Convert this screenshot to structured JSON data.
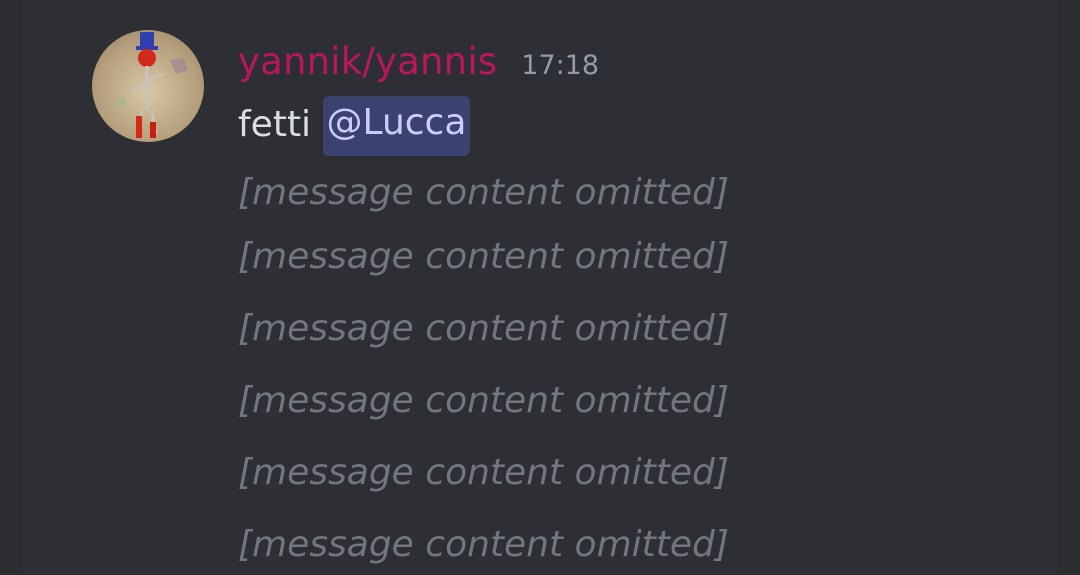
{
  "message": {
    "author": "yannik/yannis",
    "timestamp": "17:18",
    "first_line_text": "fetti",
    "mention": "@Lucca",
    "lines": [
      "[message content omitted]",
      "[message content omitted]",
      "[message content omitted]",
      "[message content omitted]",
      "[message content omitted]",
      "[message content omitted]"
    ]
  },
  "colors": {
    "background": "#2e2f34",
    "username": "#b8175a",
    "mention_bg": "#3c4270",
    "mention_text": "#c9cdfb",
    "timestamp": "#949ba4"
  },
  "icons": {
    "avatar": "user-avatar-image"
  }
}
